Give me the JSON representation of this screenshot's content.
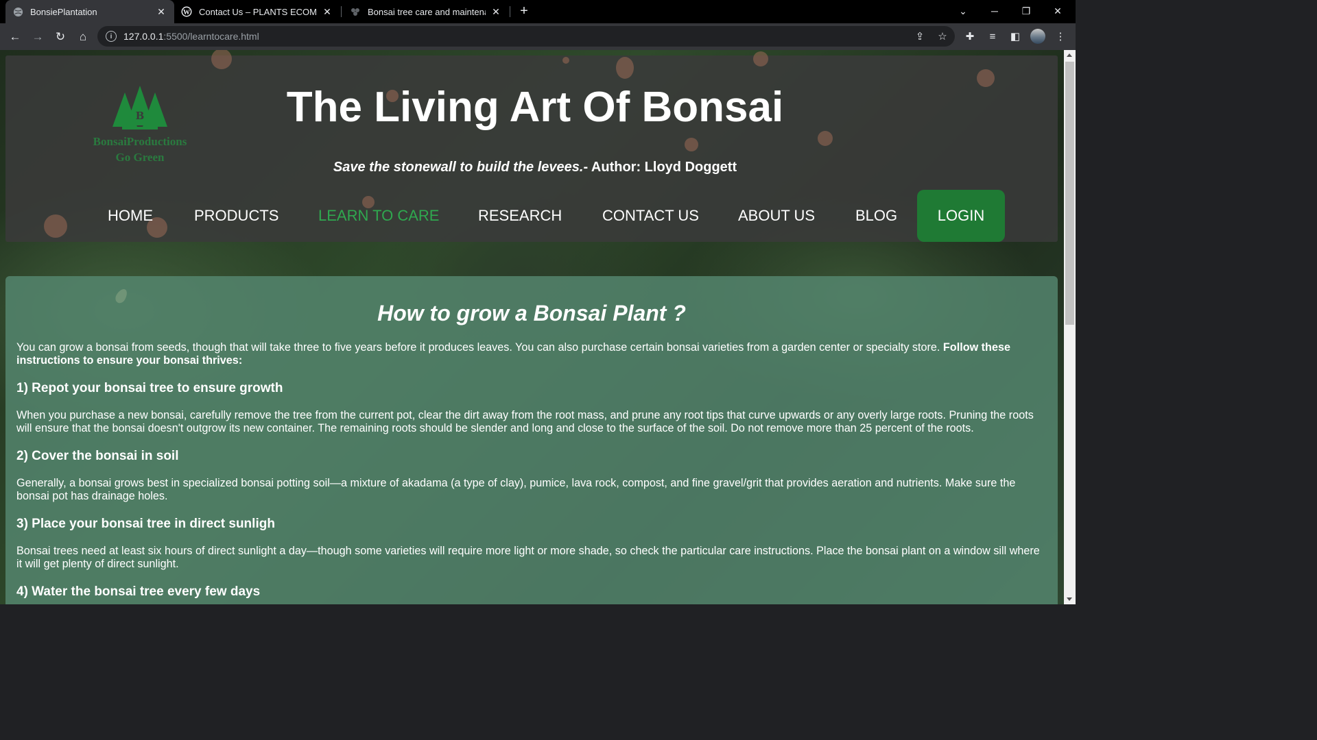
{
  "browser": {
    "tabs": [
      {
        "title": "BonsiePlantation",
        "active": true,
        "icon": "globe-icon"
      },
      {
        "title": "Contact Us – PLANTS ECOMMERCE",
        "active": false,
        "icon": "wordpress-icon"
      },
      {
        "title": "Bonsai tree care and maintenance",
        "active": false,
        "icon": "plant-icon"
      }
    ],
    "url_host": "127.0.0.1",
    "url_path": ":5500/learntocare.html"
  },
  "header": {
    "logo_name": "BonsaiProductions",
    "logo_tagline": "Go Green",
    "logo_letter": "B",
    "site_title": "The Living Art Of Bonsai",
    "quote_text": "Save the stonewall to build the levees.",
    "quote_author": "- Author: Lloyd Doggett",
    "nav": [
      "HOME",
      "PRODUCTS",
      "LEARN TO CARE",
      "RESEARCH",
      "CONTACT US",
      "ABOUT US",
      "BLOG"
    ],
    "active_nav": "LEARN TO CARE",
    "login_label": "LOGIN"
  },
  "content": {
    "title": "How to grow a Bonsai Plant ?",
    "intro": "You can grow a bonsai from seeds, though that will take three to five years before it produces leaves. You can also purchase certain bonsai varieties from a garden center or specialty store.",
    "intro_bold": "Follow these instructions to ensure your bonsai thrives:",
    "steps": [
      {
        "heading": "1) Repot your bonsai tree to ensure growth",
        "text": "When you purchase a new bonsai, carefully remove the tree from the current pot, clear the dirt away from the root mass, and prune any root tips that curve upwards or any overly large roots. Pruning the roots will ensure that the bonsai doesn't outgrow its new container. The remaining roots should be slender and long and close to the surface of the soil. Do not remove more than 25 percent of the roots."
      },
      {
        "heading": "2) Cover the bonsai in soil",
        "text": "Generally, a bonsai grows best in specialized bonsai potting soil—a mixture of akadama (a type of clay), pumice, lava rock, compost, and fine gravel/grit that provides aeration and nutrients. Make sure the bonsai pot has drainage holes."
      },
      {
        "heading": "3) Place your bonsai tree in direct sunligh",
        "text": "Bonsai trees need at least six hours of direct sunlight a day—though some varieties will require more light or more shade, so check the particular care instructions. Place the bonsai plant on a window sill where it will get plenty of direct sunlight."
      },
      {
        "heading": "4) Water the bonsai tree every few days",
        "text": ""
      }
    ]
  },
  "colors": {
    "accent_green": "#2fa84f",
    "login_bg": "#1f7a34",
    "content_bg": "#568770",
    "header_bg": "#3a3a3a"
  }
}
